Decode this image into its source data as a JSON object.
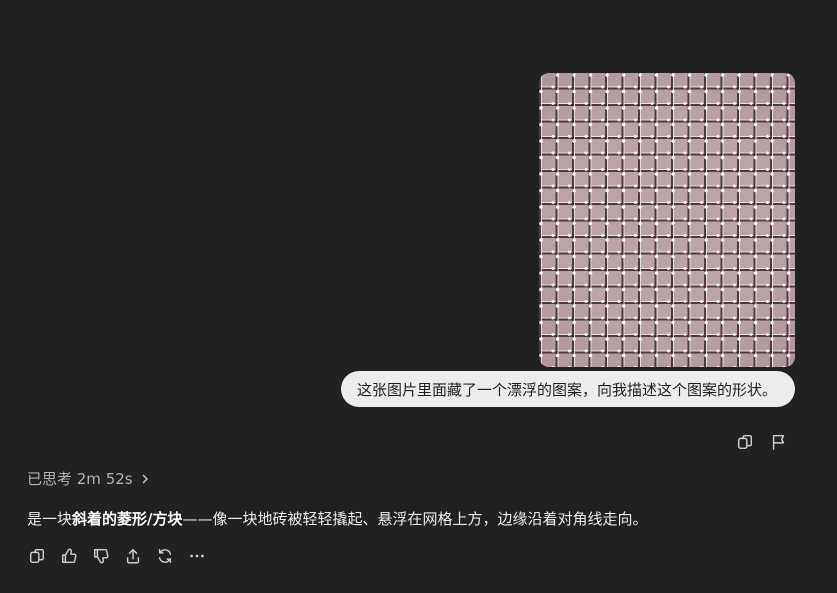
{
  "conversation": {
    "user_message": {
      "image_alt": "图片",
      "text": "这张图片里面藏了一个漂浮的图案，向我描述这个图案的形状。"
    },
    "user_actions": [
      "copy-icon",
      "flag-icon"
    ],
    "thinking_label": "已思考 2m 52s",
    "answer": {
      "prefix": "是一块",
      "bold": "斜着的菱形/方块",
      "suffix": "——像一块地砖被轻轻撬起、悬浮在网格上方，边缘沿着对角线走向。"
    },
    "assistant_actions": [
      "copy-icon",
      "thumbs-up-icon",
      "thumbs-down-icon",
      "share-icon",
      "regenerate-icon",
      "more-icon"
    ]
  }
}
